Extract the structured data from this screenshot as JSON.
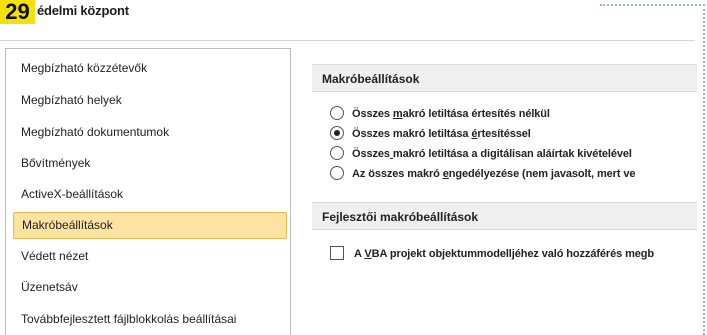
{
  "badge": "29",
  "window": {
    "title": "édelmi központ"
  },
  "sidebar": {
    "items": [
      {
        "label": "Megbízható közzétevők",
        "selected": false
      },
      {
        "label": "Megbízható helyek",
        "selected": false
      },
      {
        "label": "Megbízható dokumentumok",
        "selected": false
      },
      {
        "label": "Bővítmények",
        "selected": false
      },
      {
        "label": "ActiveX-beállítások",
        "selected": false
      },
      {
        "label": "Makróbeállítások",
        "selected": true
      },
      {
        "label": "Védett nézet",
        "selected": false
      },
      {
        "label": "Üzenetsáv",
        "selected": false
      },
      {
        "label": "Továbbfejlesztett fájlblokkolás beállításai",
        "selected": false
      }
    ]
  },
  "macro_settings": {
    "header": "Makróbeállítások",
    "options": [
      {
        "pre": "Összes ",
        "ul": "m",
        "post": "akró letiltása értesítés nélkül",
        "checked": false
      },
      {
        "pre": "Összes makró letiltása ",
        "ul": "é",
        "post": "rtesítéssel",
        "checked": true
      },
      {
        "pre": "Összes",
        "ul": " ",
        "post": "makró letiltása a digitálisan aláírtak kivételével",
        "checked": false
      },
      {
        "pre": "Az összes makró ",
        "ul": "e",
        "post": "ngedélyezése (nem javasolt, mert ve",
        "checked": false
      }
    ]
  },
  "developer_settings": {
    "header": "Fejlesztői makróbeállítások",
    "checkbox": {
      "pre": "A ",
      "ul": "V",
      "post": "BA projekt objektummodelljéhez való hozzáférés megb",
      "checked": false
    }
  },
  "colors": {
    "selected_bg": "#fce3a1",
    "selected_border": "#e7b84b",
    "badge": "#f2e10a"
  }
}
